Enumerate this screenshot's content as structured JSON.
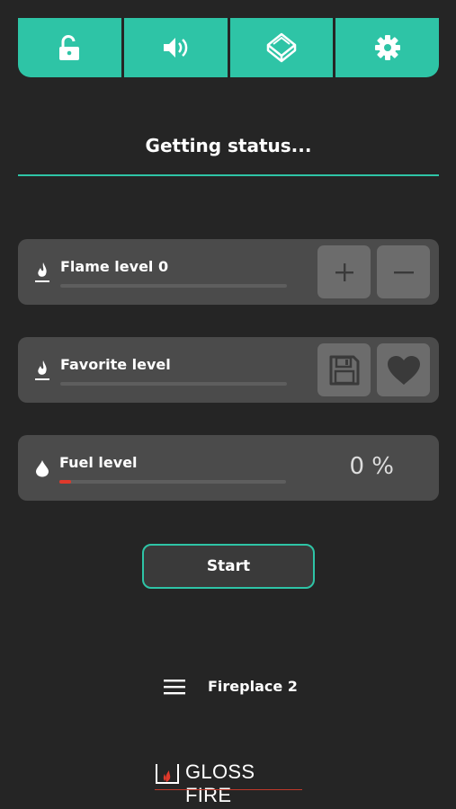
{
  "toolbar": {
    "buttons": [
      {
        "icon": "unlock-icon"
      },
      {
        "icon": "speaker-icon"
      },
      {
        "icon": "fireplace-cube-icon"
      },
      {
        "icon": "gear-icon"
      }
    ]
  },
  "status_text": "Getting status...",
  "flame": {
    "label": "Flame level",
    "value": "0",
    "level": 0
  },
  "favorite": {
    "label": "Favorite level",
    "level": 0
  },
  "fuel": {
    "label": "Fuel level",
    "percent_text": "0 %",
    "level_fraction": 0.05
  },
  "start_label": "Start",
  "device_name": "Fireplace 2",
  "logo_text": "GLOSS FIRE",
  "colors": {
    "accent": "#2ec4a6",
    "background": "#252525",
    "card": "#4b4b4b",
    "fuel_fill": "#e0392b"
  }
}
